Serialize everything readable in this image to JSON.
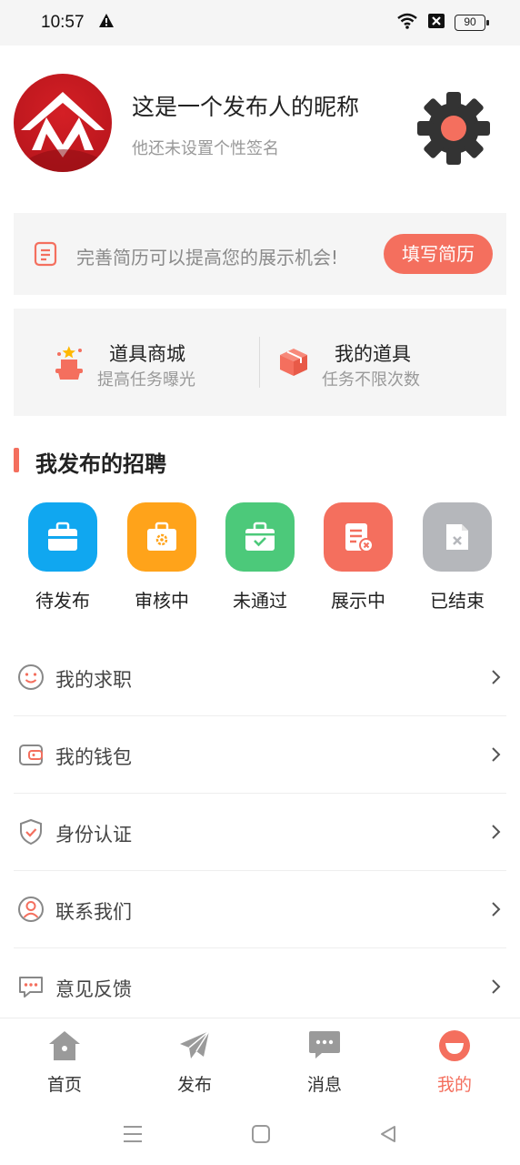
{
  "status_bar": {
    "time": "10:57",
    "battery": "90"
  },
  "profile": {
    "nickname": "这是一个发布人的昵称",
    "signature": "他还未设置个性签名"
  },
  "resume_banner": {
    "text": "完善简历可以提高您的展示机会!",
    "button": "填写简历"
  },
  "tools": [
    {
      "title": "道具商城",
      "subtitle": "提高任务曝光",
      "icon": "hat-star-icon"
    },
    {
      "title": "我的道具",
      "subtitle": "任务不限次数",
      "icon": "box-icon"
    }
  ],
  "section": {
    "title": "我发布的招聘"
  },
  "job_status": [
    {
      "label": "待发布",
      "color": "#10a7f0",
      "icon": "briefcase-icon"
    },
    {
      "label": "审核中",
      "color": "#ffa31a",
      "icon": "briefcase-gear-icon"
    },
    {
      "label": "未通过",
      "color": "#4cc97a",
      "icon": "briefcase-check-icon"
    },
    {
      "label": "展示中",
      "color": "#f46f5e",
      "icon": "document-x-icon"
    },
    {
      "label": "已结束",
      "color": "#b5b7bb",
      "icon": "file-x-icon"
    }
  ],
  "menu": [
    {
      "label": "我的求职",
      "icon": "smile-icon"
    },
    {
      "label": "我的钱包",
      "icon": "wallet-icon"
    },
    {
      "label": "身份认证",
      "icon": "shield-check-icon"
    },
    {
      "label": "联系我们",
      "icon": "user-circle-icon"
    },
    {
      "label": "意见反馈",
      "icon": "chat-bubble-icon"
    }
  ],
  "bottom_nav": [
    {
      "label": "首页",
      "icon": "home-icon"
    },
    {
      "label": "发布",
      "icon": "paper-plane-icon"
    },
    {
      "label": "消息",
      "icon": "message-icon"
    },
    {
      "label": "我的",
      "icon": "profile-icon",
      "active": true
    }
  ],
  "colors": {
    "accent": "#f46f5e",
    "panel": "#f5f5f5"
  }
}
